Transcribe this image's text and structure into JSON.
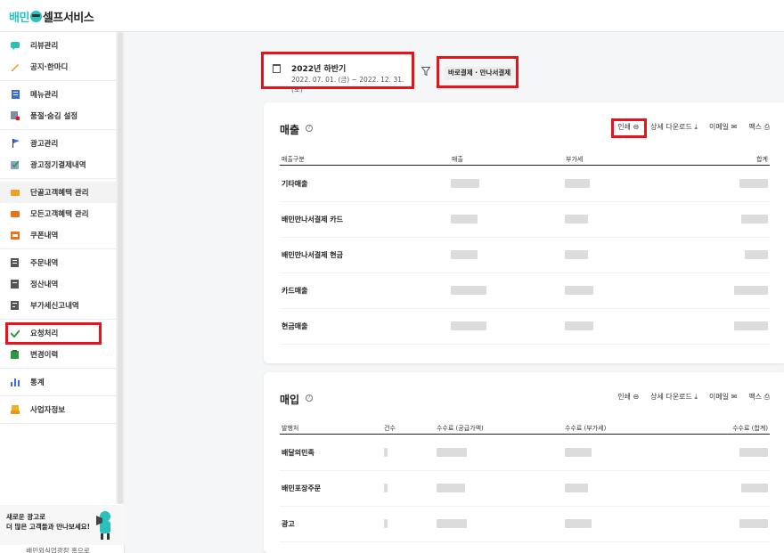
{
  "header": {
    "logo_prefix": "배민",
    "logo_rest": "셀프서비스"
  },
  "sidebar": {
    "groups": [
      {
        "items": [
          {
            "label": "리뷰관리",
            "icon": "chat-icon"
          },
          {
            "label": "공지·한마디",
            "icon": "pencil-icon"
          }
        ]
      },
      {
        "items": [
          {
            "label": "메뉴관리",
            "icon": "menu-book-icon"
          },
          {
            "label": "품절·숨김 설정",
            "icon": "soldout-icon"
          }
        ]
      },
      {
        "items": [
          {
            "label": "광고관리",
            "icon": "flag-icon"
          },
          {
            "label": "광고정기결제내역",
            "icon": "check-doc-icon"
          }
        ]
      },
      {
        "items": [
          {
            "label": "단골고객혜택 관리",
            "icon": "ticket-icon"
          },
          {
            "label": "모든고객혜택 관리",
            "icon": "ticket-icon"
          },
          {
            "label": "쿠폰내역",
            "icon": "coupon-icon"
          }
        ]
      },
      {
        "items": [
          {
            "label": "주문내역",
            "icon": "order-list-icon"
          },
          {
            "label": "정산내역",
            "icon": "settlement-icon"
          },
          {
            "label": "부가세신고내역",
            "icon": "tax-report-icon"
          }
        ]
      },
      {
        "items": [
          {
            "label": "요청처리",
            "icon": "check-icon"
          },
          {
            "label": "변경이력",
            "icon": "history-icon"
          }
        ]
      },
      {
        "items": [
          {
            "label": "통계",
            "icon": "bar-chart-icon"
          }
        ]
      },
      {
        "items": [
          {
            "label": "사업자정보",
            "icon": "business-doc-icon"
          }
        ]
      }
    ],
    "promo": {
      "line1": "새로운 광고로",
      "line2": "더 많은 고객들과 만나보세요!"
    },
    "sub_link": "배민외식업광장 홈으로"
  },
  "filter": {
    "title": "2022년 하반기",
    "range": "2022. 07. 01. (금) ~ 2022. 12. 31. (토)"
  },
  "chip": {
    "label": "바로결제 · 만나서결제"
  },
  "actions": {
    "print": "인쇄",
    "download": "상세 다운로드",
    "email": "이메일",
    "fax": "팩스"
  },
  "sales": {
    "title": "매출",
    "columns": [
      "매출구분",
      "매출",
      "부가세",
      "합계"
    ],
    "rows": [
      "기타매출",
      "배민만나서결제 카드",
      "배민만나서결제 현금",
      "카드매출",
      "현금매출"
    ]
  },
  "purchase": {
    "title": "매입",
    "columns": [
      "발행처",
      "건수",
      "수수료 (공급가액)",
      "수수료 (부가세)",
      "수수료 (합계)"
    ],
    "rows": [
      "배달의민족",
      "배민포장주문",
      "광고"
    ]
  },
  "colors": {
    "brand": "#2ac1bc",
    "highlight": "#e8121a"
  }
}
